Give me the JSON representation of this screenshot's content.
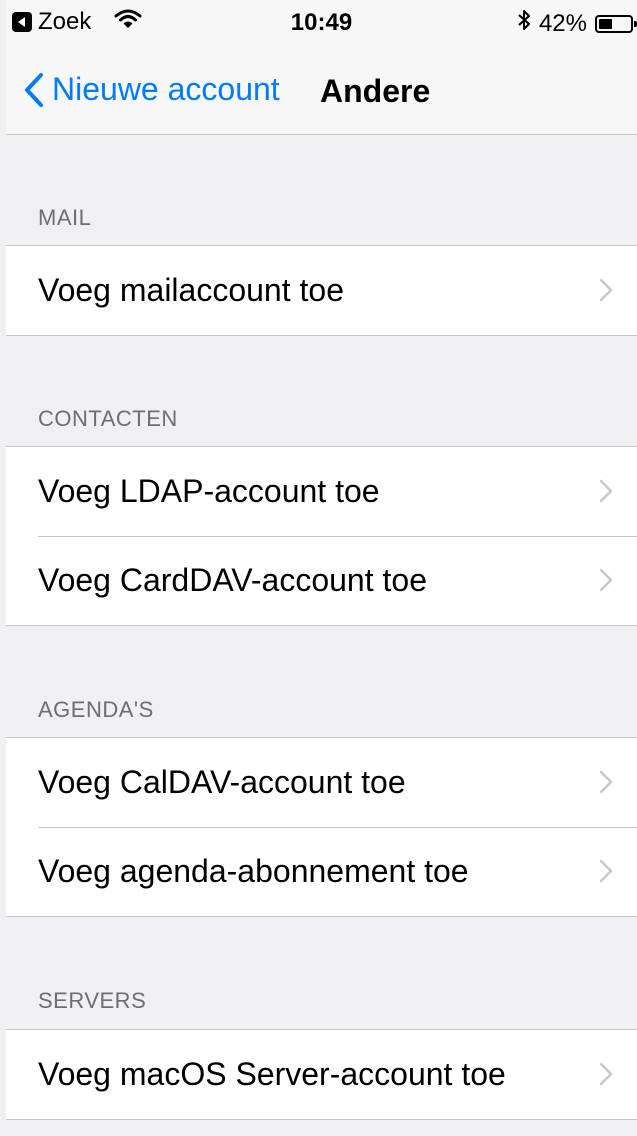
{
  "status_bar": {
    "back_app_label": "Zoek",
    "time": "10:49",
    "battery_percent": "42%",
    "battery_level": 0.42
  },
  "nav": {
    "back_label": "Nieuwe account",
    "title": "Andere"
  },
  "sections": [
    {
      "header": "MAIL",
      "items": [
        "Voeg mailaccount toe"
      ]
    },
    {
      "header": "CONTACTEN",
      "items": [
        "Voeg LDAP-account toe",
        "Voeg CardDAV-account toe"
      ]
    },
    {
      "header": "AGENDA'S",
      "items": [
        "Voeg CalDAV-account toe",
        "Voeg agenda-abonnement toe"
      ]
    },
    {
      "header": "SERVERS",
      "items": [
        "Voeg macOS Server-account toe"
      ]
    }
  ],
  "colors": {
    "accent": "#007aff",
    "background": "#efeff4",
    "separator": "#c8c7cc",
    "header_text": "#6d6d72",
    "chevron": "#c7c7cc"
  },
  "icons": {
    "back_app": "back-triangle-icon",
    "wifi": "wifi-icon",
    "bluetooth": "bluetooth-icon",
    "battery": "battery-icon",
    "nav_back": "chevron-left-icon",
    "row": "chevron-right-icon"
  }
}
